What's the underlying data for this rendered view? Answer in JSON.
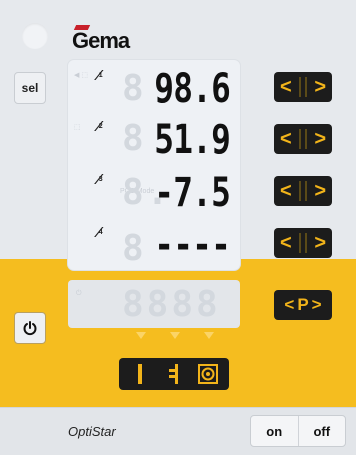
{
  "brand": {
    "logo_text": "Gema",
    "accent": "#c8202a"
  },
  "colors": {
    "panel": "#e6e9ed",
    "yellow": "#f5bd1f",
    "button_bg": "#1c1c1c",
    "button_fg": "#f2b41a"
  },
  "controls": {
    "sel_label": "sel",
    "p_label": "P"
  },
  "rows": [
    {
      "icon": "spray-gun-icon",
      "index": "1",
      "value": "98.6"
    },
    {
      "icon": "spray-gun-icon",
      "index": "2",
      "value": "51.9"
    },
    {
      "icon": "spray-gun-icon",
      "index": "3",
      "value": "-7.5"
    },
    {
      "icon": "spray-gun-icon",
      "index": "4",
      "value": "----"
    }
  ],
  "ghost_labels": {
    "row1": "µA",
    "row2": "kV",
    "row4": "PCC Mode"
  },
  "modes": [
    "manual-mode-icon",
    "custom-mode-icon",
    "preset-mode-icon"
  ],
  "footer": {
    "model": "OptiStar",
    "on_label": "on",
    "off_label": "off"
  }
}
